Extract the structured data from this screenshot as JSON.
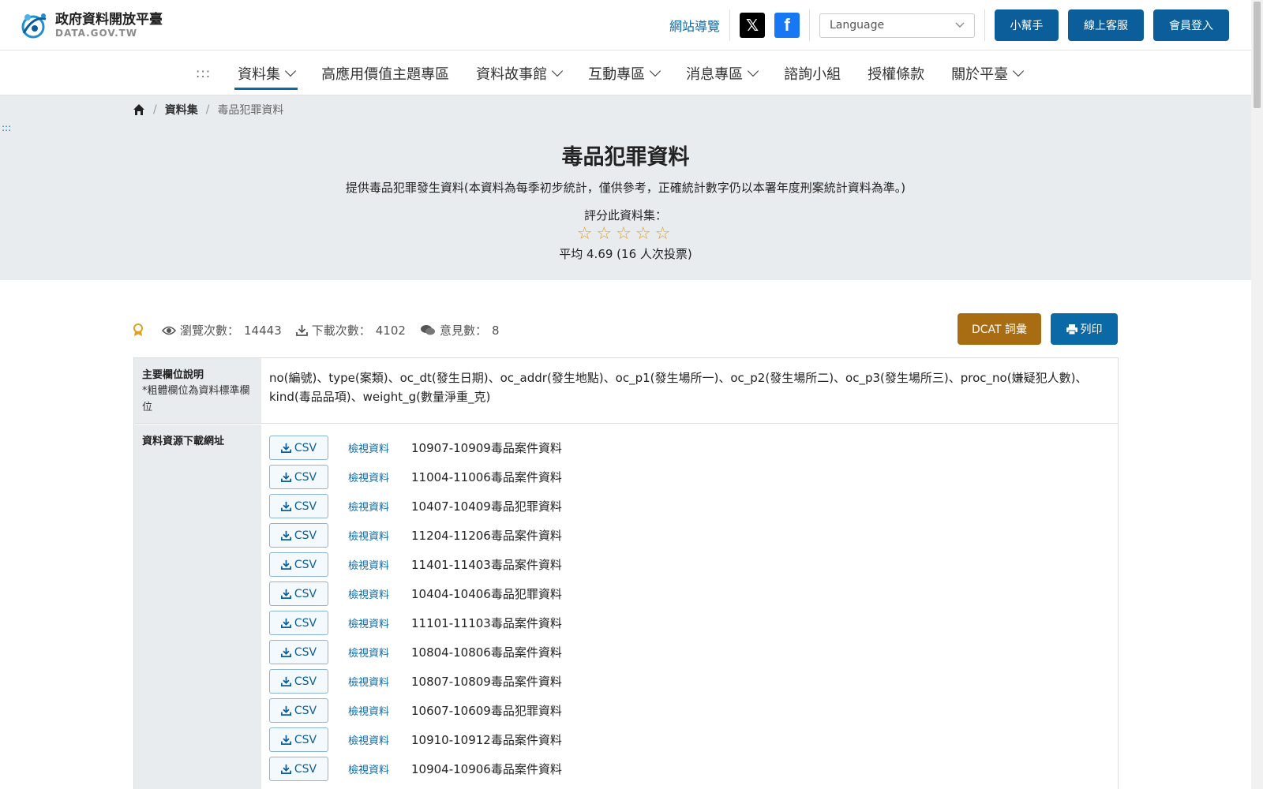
{
  "header": {
    "logo_main": "政府資料開放平臺",
    "logo_sub": "DATA.GOV.TW",
    "sitemap": "網站導覽",
    "language_placeholder": "Language",
    "buttons": {
      "helper": "小幫手",
      "service": "線上客服",
      "login": "會員登入"
    },
    "colors": {
      "primary": "#0b5e9a",
      "x": "#000000",
      "facebook": "#1877f2"
    }
  },
  "nav": {
    "accesskey": ":::",
    "items": [
      {
        "label": "資料集",
        "dropdown": true,
        "active": true
      },
      {
        "label": "高應用價值主題專區",
        "dropdown": false
      },
      {
        "label": "資料故事館",
        "dropdown": true
      },
      {
        "label": "互動專區",
        "dropdown": true
      },
      {
        "label": "消息專區",
        "dropdown": true
      },
      {
        "label": "諮詢小組",
        "dropdown": false
      },
      {
        "label": "授權條款",
        "dropdown": false
      },
      {
        "label": "關於平臺",
        "dropdown": true
      }
    ]
  },
  "breadcrumb": {
    "home_icon": "home-icon",
    "datasets": "資料集",
    "current": "毒品犯罪資料"
  },
  "side_accesskey": ":::",
  "dataset": {
    "title": "毒品犯罪資料",
    "description": "提供毒品犯罪發生資料(本資料為每季初步統計，僅供參考，正確統計數字仍以本署年度刑案統計資料為準。)",
    "rating_label": "評分此資料集：",
    "stars": "☆☆☆☆☆",
    "average": "平均 4.69 (16 人次投票)"
  },
  "stats": {
    "views_label": "瀏覽次數：",
    "views": "14443",
    "downloads_label": "下載次數：",
    "downloads": "4102",
    "comments_label": "意見數：",
    "comments": "8"
  },
  "actions": {
    "dcat": "DCAT 詞彙",
    "print": "列印",
    "dcat_color": "#a86d12"
  },
  "table": {
    "fields_label": "主要欄位說明",
    "fields_note": "*粗體欄位為資料標準欄位",
    "fields_value": "no(編號)、type(案類)、oc_dt(發生日期)、oc_addr(發生地點)、oc_p1(發生場所一)、oc_p2(發生場所二)、oc_p3(發生場所三)、proc_no(嫌疑犯人數)、kind(毒品品項)、weight_g(數量淨重_克)",
    "resources_label": "資料資源下載網址",
    "csv_label": "CSV",
    "view_label": "檢視資料",
    "resources": [
      "10907-10909毒品案件資料",
      "11004-11006毒品案件資料",
      "10407-10409毒品犯罪資料",
      "11204-11206毒品案件資料",
      "11401-11403毒品案件資料",
      "10404-10406毒品犯罪資料",
      "11101-11103毒品案件資料",
      "10804-10806毒品案件資料",
      "10807-10809毒品案件資料",
      "10607-10609毒品犯罪資料",
      "10910-10912毒品案件資料",
      "10904-10906毒品案件資料"
    ]
  }
}
